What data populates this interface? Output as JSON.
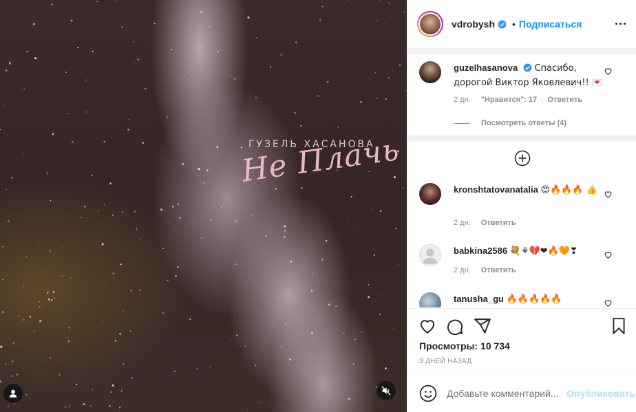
{
  "media": {
    "artist_text": "ГУЗЕЛЬ ХАСАНОВА",
    "title_text": "Не Плачь",
    "tag_icon": "user-icon",
    "mute_icon": "speaker-muted-icon"
  },
  "header": {
    "username": "vdrobysh",
    "separator": "•",
    "follow_label": "Подписаться"
  },
  "comments": [
    {
      "username": "guzelhasanova",
      "verified": true,
      "text": "Спасибо, дорогой Виктор Яковлевич!! 💌",
      "time": "2 дн.",
      "likes": "\"Нравится\": 17",
      "reply": "Ответить",
      "view_replies": "Посмотреть ответы (4)"
    },
    {
      "username": "kronshtatovanatalia",
      "text": "😍🔥🔥🔥 👍",
      "time": "2 дн.",
      "reply": "Ответить"
    },
    {
      "username": "babkina2586",
      "text": "💐⚘💔❤🔥🧡❣",
      "time": "2 дн.",
      "reply": "Ответить"
    },
    {
      "username": "tanusha_gu",
      "text": "🔥🔥🔥🔥🔥"
    }
  ],
  "stats": {
    "views": "Просмотры: 10 734",
    "posted": "3 ДНЕЙ НАЗАД"
  },
  "add_comment": {
    "placeholder": "Добавьте комментарий...",
    "publish_label": "Опубликовать"
  },
  "colors": {
    "accent": "#0095f6",
    "publish_disabled": "#b2dffc",
    "secondary_text": "#8e8e8e"
  }
}
